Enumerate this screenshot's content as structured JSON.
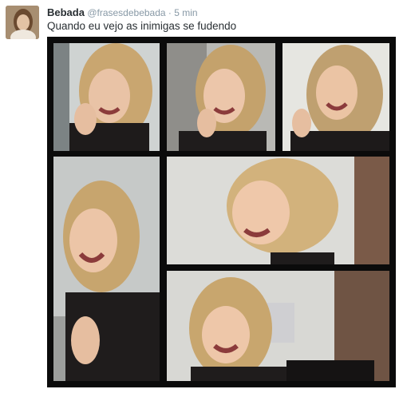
{
  "tweet": {
    "display_name": "Bebada",
    "handle": "@frasesdebebada",
    "separator": "·",
    "time": "5 min",
    "text": "Quando eu vejo as inimigas se fudendo"
  },
  "media": {
    "panels": [
      {
        "id": "p1",
        "description": "woman laughing, hand on cheek"
      },
      {
        "id": "p2",
        "description": "woman smiling, hand on chin"
      },
      {
        "id": "p3",
        "description": "woman laughing, looking up"
      },
      {
        "id": "p4",
        "description": "woman laughing, eyes closed"
      },
      {
        "id": "p5",
        "description": "woman laughing, close-up"
      },
      {
        "id": "p6",
        "description": "woman laughing, head tilted"
      }
    ]
  }
}
